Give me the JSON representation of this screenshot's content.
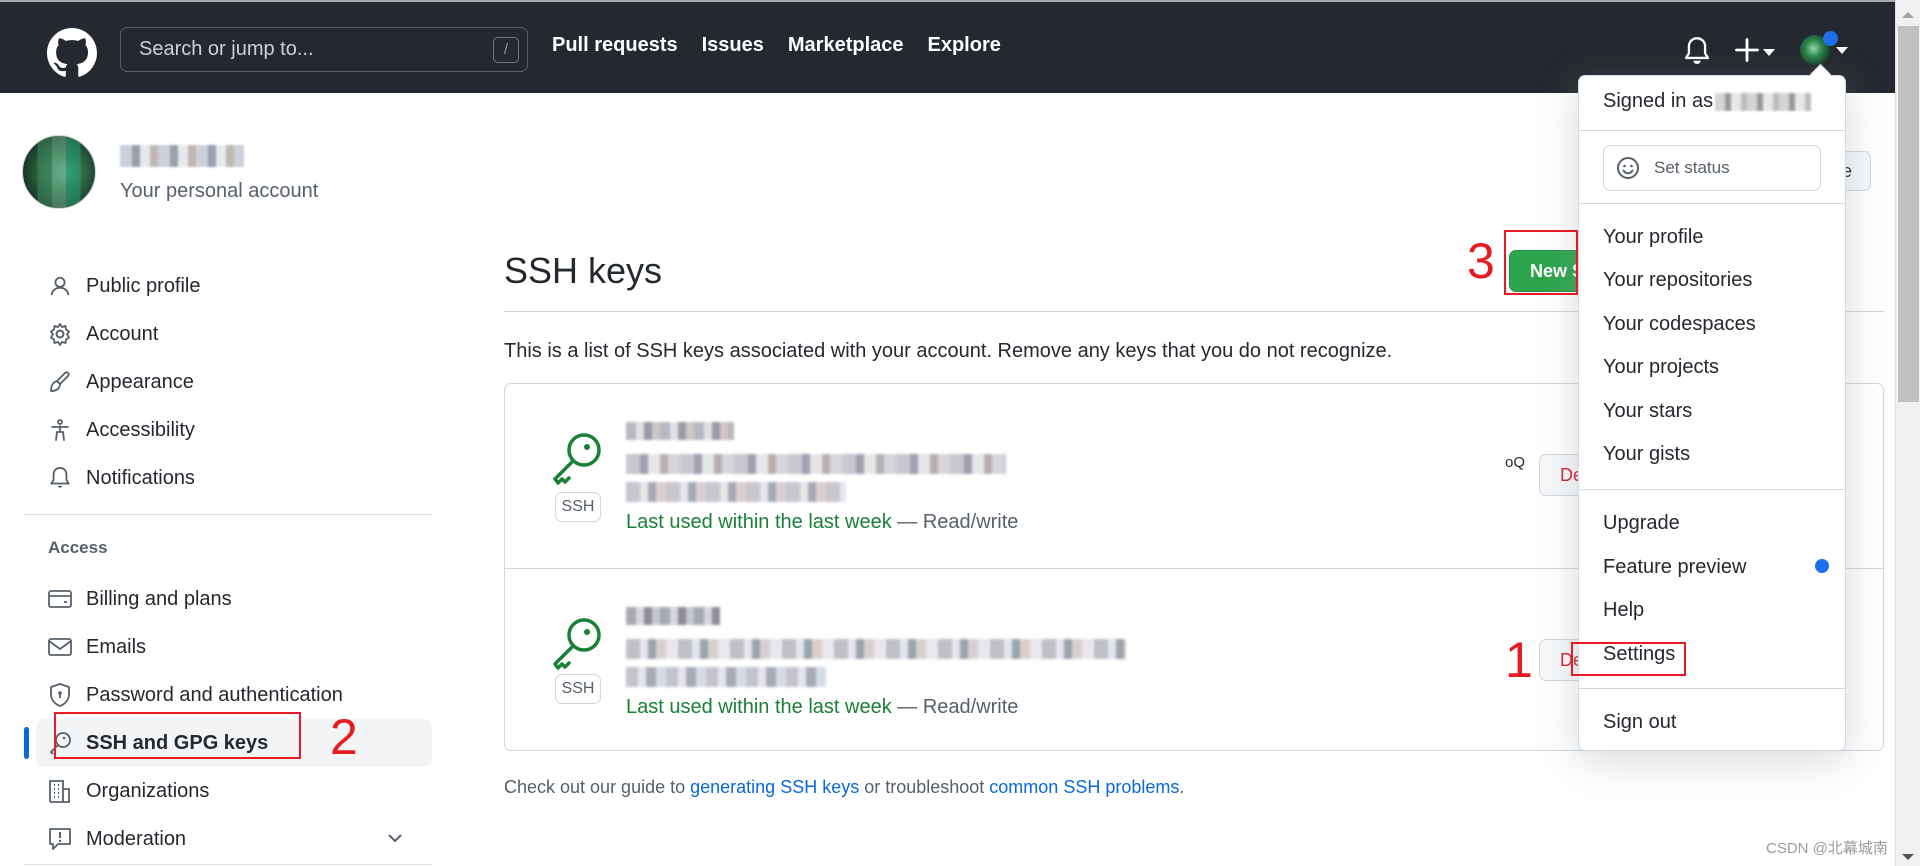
{
  "header": {
    "search_placeholder": "Search or jump to...",
    "search_shortcut": "/",
    "nav": [
      "Pull requests",
      "Issues",
      "Marketplace",
      "Explore"
    ],
    "icons": {
      "logo": "github-logo-icon",
      "bell": "bell-icon",
      "plus": "plus-icon",
      "avatar": "user-avatar",
      "unread_dot_color": "#1f6feb"
    },
    "background_color": "#24292f"
  },
  "profile": {
    "name": "[redacted]",
    "subtitle": "Your personal account"
  },
  "sidebar": {
    "items": [
      {
        "label": "Public profile",
        "icon": "person-icon"
      },
      {
        "label": "Account",
        "icon": "gear-icon"
      },
      {
        "label": "Appearance",
        "icon": "paintbrush-icon"
      },
      {
        "label": "Accessibility",
        "icon": "accessibility-icon"
      },
      {
        "label": "Notifications",
        "icon": "bell-icon"
      }
    ],
    "group_label": "Access",
    "access_items": [
      {
        "label": "Billing and plans",
        "icon": "credit-card-icon"
      },
      {
        "label": "Emails",
        "icon": "mail-icon"
      },
      {
        "label": "Password and authentication",
        "icon": "shield-lock-icon"
      },
      {
        "label": "SSH and GPG keys",
        "icon": "key-icon",
        "active": true
      },
      {
        "label": "Organizations",
        "icon": "organization-icon"
      },
      {
        "label": "Moderation",
        "icon": "report-icon",
        "expandable": true
      }
    ],
    "active_color": "#0969da"
  },
  "main": {
    "title": "SSH keys",
    "new_button_label": "New SSH key",
    "new_button_visible_text": "New S",
    "description": "This is a list of SSH keys associated with your account. Remove any keys that you do not recognize.",
    "keys": [
      {
        "title": "[redacted]",
        "fingerprint_suffix": "oQ",
        "badge": "SSH",
        "last_used": "Last used within the last week",
        "access": "— Read/write",
        "delete_label": "Delete",
        "delete_visible_text": "De"
      },
      {
        "title": "[redacted]",
        "fingerprint_suffix": "",
        "badge": "SSH",
        "last_used": "Last used within the last week",
        "access": "— Read/write",
        "delete_label": "Delete",
        "delete_visible_text": "De"
      }
    ],
    "footer": {
      "prefix": "Check out our guide to ",
      "link1": "generating SSH keys",
      "middle": " or troubleshoot ",
      "link2": "common SSH problems",
      "suffix": "."
    },
    "behind_button_visible_text": "e",
    "accent_green": "#2da44e",
    "danger_red": "#cf222e",
    "used_green": "#1a7f37",
    "link_blue": "#0969da"
  },
  "dropdown": {
    "signed_in_prefix": "Signed in as",
    "set_status": "Set status",
    "group1": [
      "Your profile",
      "Your repositories",
      "Your codespaces",
      "Your projects",
      "Your stars",
      "Your gists"
    ],
    "group2": [
      "Upgrade",
      "Feature preview",
      "Help",
      "Settings"
    ],
    "sign_out": "Sign out",
    "feature_preview_dot_color": "#1f6feb"
  },
  "annotations": [
    {
      "number": "1",
      "target": "Settings"
    },
    {
      "number": "2",
      "target": "SSH and GPG keys"
    },
    {
      "number": "3",
      "target": "New SSH key"
    }
  ],
  "annotation_color": "#e81b23",
  "watermark": "CSDN @北幕城南"
}
